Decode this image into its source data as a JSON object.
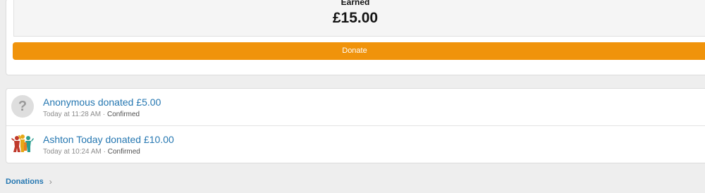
{
  "earned": {
    "label": "Earned",
    "value": "£15.00"
  },
  "donate_button": {
    "label": "Donate",
    "color": "#f0930b"
  },
  "donations": [
    {
      "title": "Anonymous donated £5.00",
      "time": "Today at 11:28 AM",
      "separator": " · ",
      "status": "Confirmed",
      "avatar": "anonymous-avatar-icon"
    },
    {
      "title": "Ashton Today donated £10.00",
      "time": "Today at 10:24 AM",
      "separator": " · ",
      "status": "Confirmed",
      "avatar": "ashton-today-logo"
    }
  ],
  "footer": {
    "link_label": "Donations",
    "chevron": "›"
  },
  "colors": {
    "link": "#2577b1",
    "background": "#eeeeee"
  }
}
